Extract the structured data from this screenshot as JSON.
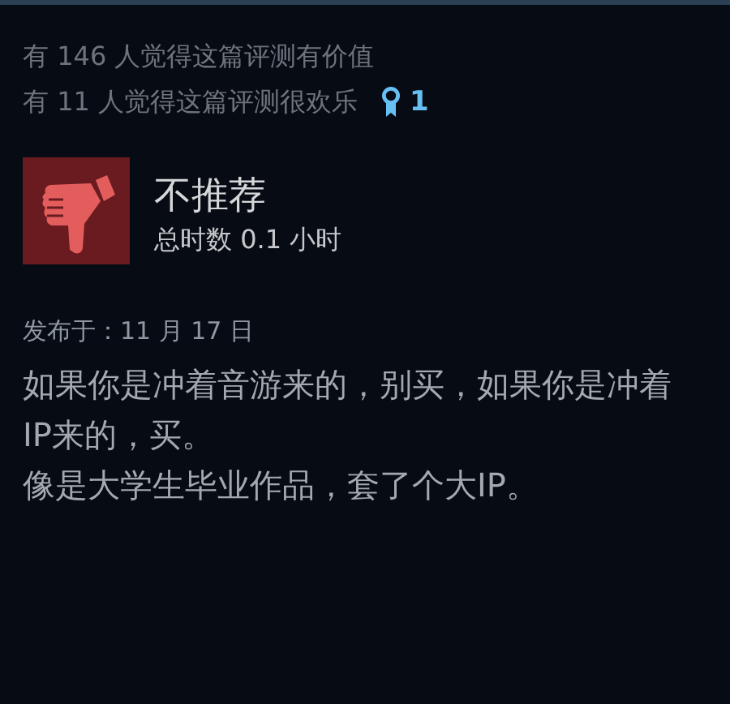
{
  "votes": [
    {
      "text": "有 146 人觉得这篇评测有价值"
    },
    {
      "text": "有 11 人觉得这篇评测很欢乐",
      "award_count": "1"
    }
  ],
  "review": {
    "recommended": false,
    "title": "不推荐",
    "hours": "总时数 0.1 小时",
    "posted": "发布于：11 月 17 日",
    "paragraphs": [
      "如果你是冲着音游来的，别买，如果你是冲着IP来的，买。",
      "像是大学生毕业作品，套了个大IP。"
    ]
  }
}
